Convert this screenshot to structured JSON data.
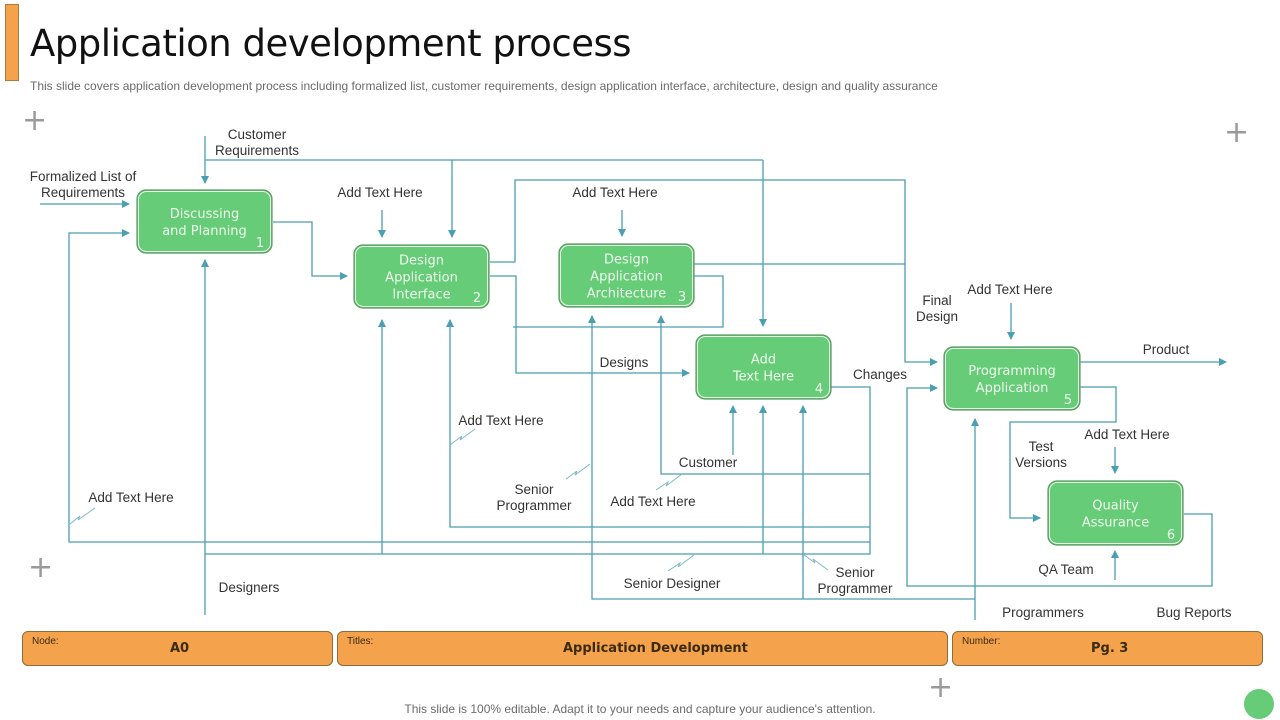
{
  "header": {
    "title": "Application development process",
    "subtitle": "This slide covers application development process including formalized list, customer requirements, design application interface, architecture, design and quality assurance"
  },
  "colors": {
    "node_fill": "#66cc77",
    "connector": "#4a9fb0",
    "info_fill": "#f4a24c"
  },
  "nodes": [
    {
      "id": 1,
      "lines": [
        "Discussing",
        "and Planning"
      ],
      "number": "1"
    },
    {
      "id": 2,
      "lines": [
        "Design",
        "Application",
        "Interface"
      ],
      "number": "2"
    },
    {
      "id": 3,
      "lines": [
        "Design",
        "Application",
        "Architecture"
      ],
      "number": "3"
    },
    {
      "id": 4,
      "lines": [
        "Add",
        "Text Here"
      ],
      "number": "4"
    },
    {
      "id": 5,
      "lines": [
        "Programming",
        "Application"
      ],
      "number": "5"
    },
    {
      "id": 6,
      "lines": [
        "Quality",
        "Assurance"
      ],
      "number": "6"
    }
  ],
  "labels": {
    "customer_requirements": [
      "Customer",
      "Requirements"
    ],
    "formalized_list": [
      "Formalized List of",
      "Requirements"
    ],
    "add_text_node2": "Add Text Here",
    "add_text_node3": "Add Text Here",
    "final_design": [
      "Final",
      "Design"
    ],
    "add_text_node5": "Add Text Here",
    "product": "Product",
    "designs": "Designs",
    "changes": "Changes",
    "add_text_mid": "Add Text Here",
    "test_versions": [
      "Test",
      "Versions"
    ],
    "add_text_node6": "Add Text Here",
    "customer": "Customer",
    "senior_programmer_1": [
      "Senior",
      "Programmer"
    ],
    "add_text_lower": "Add Text Here",
    "add_text_left": "Add Text Here",
    "qa_team": "QA Team",
    "designers": "Designers",
    "senior_designer": "Senior Designer",
    "senior_programmer_2": [
      "Senior",
      "Programmer"
    ],
    "programmers": "Programmers",
    "bug_reports": "Bug Reports"
  },
  "info_bar": {
    "node_label": "Node:",
    "node_value": "A0",
    "titles_label": "Titles:",
    "titles_value": "Application Development",
    "number_label": "Number:",
    "number_value": "Pg. 3"
  },
  "footer": {
    "note": "This slide is 100% editable. Adapt it to your needs and capture your audience's attention."
  }
}
